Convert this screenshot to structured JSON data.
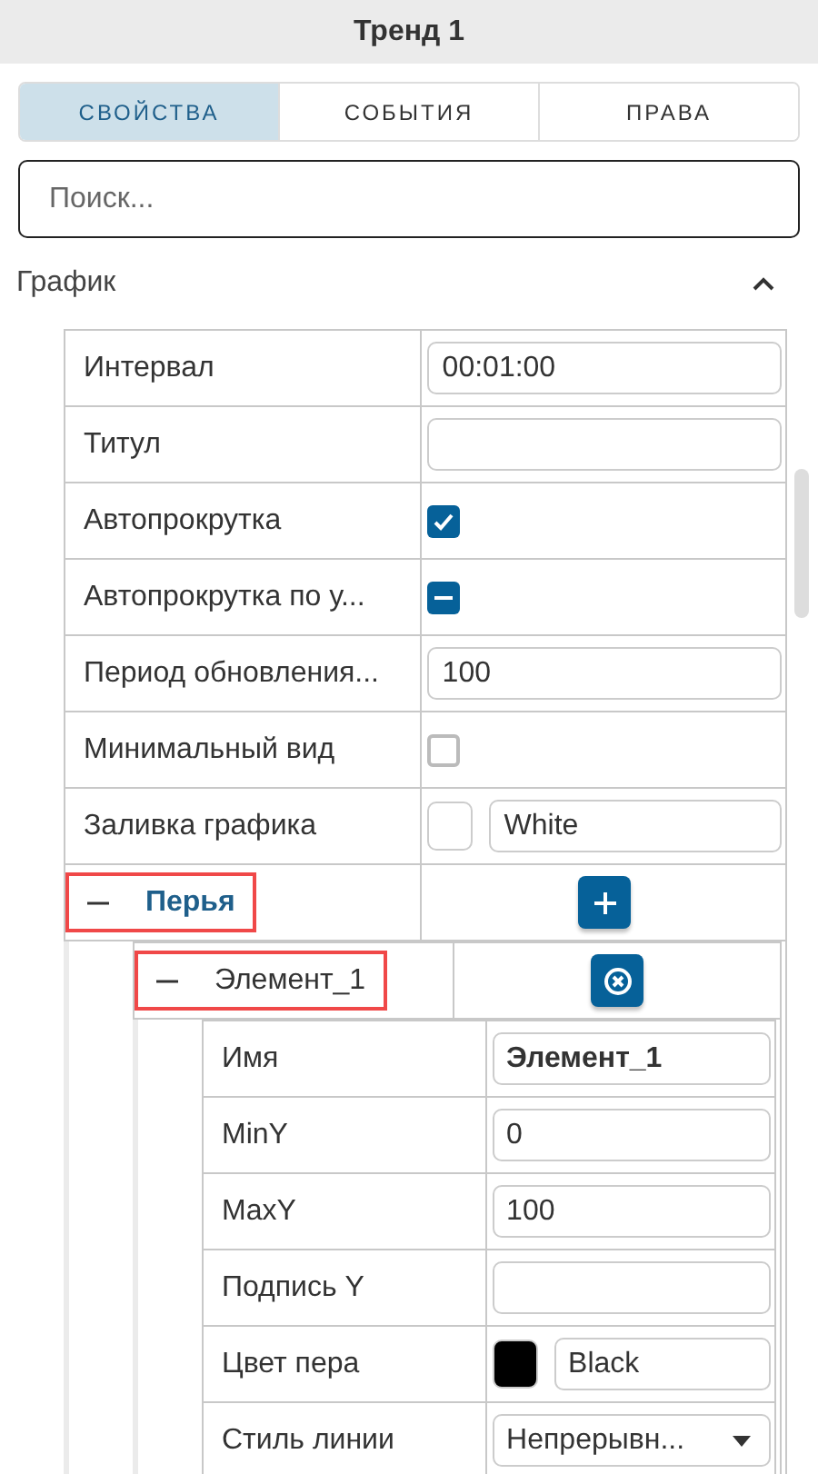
{
  "panel_title": "Тренд 1",
  "tabs": [
    {
      "label": "СВОЙСТВА",
      "selected": true
    },
    {
      "label": "СОБЫТИЯ",
      "selected": false
    },
    {
      "label": "ПРАВА",
      "selected": false
    }
  ],
  "search": {
    "placeholder": "Поиск..."
  },
  "section": {
    "title": "График",
    "expanded": true,
    "rows": [
      {
        "kind": "input",
        "label": "Интервал",
        "value": "00:01:00"
      },
      {
        "kind": "input",
        "label": "Титул"
      },
      {
        "kind": "checkbox",
        "label": "Автопрокрутка",
        "checked": true
      },
      {
        "kind": "partial",
        "label": "Автопрокрутка по у...",
        "indeterminate": true
      },
      {
        "kind": "input",
        "label": "Период обновления...",
        "value": "100"
      },
      {
        "kind": "checkbox",
        "label": "Минимальный вид",
        "checked": false
      },
      {
        "kind": "color",
        "label": "Заливка графика",
        "color": "#ffffff",
        "value": "White"
      },
      {
        "kind": "addgroup",
        "label": "Перья",
        "expanded": true,
        "highlighted": true,
        "children": [
          {
            "kind": "removegroup",
            "label": "Элемент_1",
            "expanded": true,
            "highlighted": true,
            "children": [
              {
                "kind": "input",
                "label": "Имя",
                "value": "Элемент_1",
                "bold": true
              },
              {
                "kind": "input",
                "label": "MinY",
                "value": "0"
              },
              {
                "kind": "input",
                "label": "MaxY",
                "value": "100"
              },
              {
                "kind": "input",
                "label": "Подпись Y"
              },
              {
                "kind": "color",
                "label": "Цвет пера",
                "color": "#000000",
                "value": "Black"
              },
              {
                "kind": "select",
                "label": "Стиль линии",
                "value": "Непрерывн..."
              }
            ]
          }
        ]
      }
    ]
  }
}
